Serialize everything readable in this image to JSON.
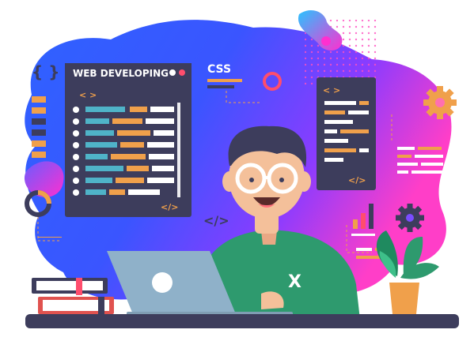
{
  "panel_main": {
    "title": "WEB DEVELOPING",
    "open_tag": "< >",
    "close_tag": "</>"
  },
  "css_label": "CSS",
  "panel_right": {
    "open_tag": "< >",
    "close_tag": "</>"
  },
  "brace_icon": "{ }",
  "code_tag_icon": "</>",
  "shirt_letter": "X",
  "colors": {
    "panel": "#3d3d5c",
    "accent_orange": "#f0a04b",
    "accent_teal": "#4fb3c8",
    "skin": "#f4c09a",
    "shirt": "#2e9a6e",
    "blob_blue": "#3a5bff",
    "blob_pink": "#ff3ec8"
  }
}
